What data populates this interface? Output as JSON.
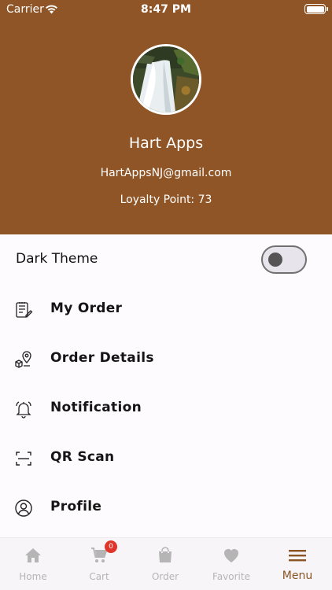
{
  "status_bar": {
    "carrier": "Carrier",
    "time": "8:47 PM"
  },
  "profile": {
    "name": "Hart Apps",
    "email": "HartAppsNJ@gmail.com",
    "loyalty": "Loyalty Point: 73"
  },
  "settings": {
    "dark_theme_label": "Dark Theme",
    "dark_theme_on": false
  },
  "menu": {
    "items": [
      {
        "label": "My Order",
        "icon": "order-list-icon"
      },
      {
        "label": "Order Details",
        "icon": "location-box-icon"
      },
      {
        "label": "Notification",
        "icon": "bell-icon"
      },
      {
        "label": "QR Scan",
        "icon": "qr-scan-icon"
      },
      {
        "label": "Profile",
        "icon": "profile-icon"
      }
    ]
  },
  "tabbar": {
    "items": [
      {
        "label": "Home",
        "icon": "home-icon"
      },
      {
        "label": "Cart",
        "icon": "cart-icon",
        "badge": "0"
      },
      {
        "label": "Order",
        "icon": "bag-icon"
      },
      {
        "label": "Favorite",
        "icon": "heart-icon"
      },
      {
        "label": "Menu",
        "icon": "menu-icon",
        "active": true
      }
    ]
  },
  "colors": {
    "header_bg": "#8f5526",
    "accent": "#8a5424",
    "badge": "#e0352b"
  }
}
